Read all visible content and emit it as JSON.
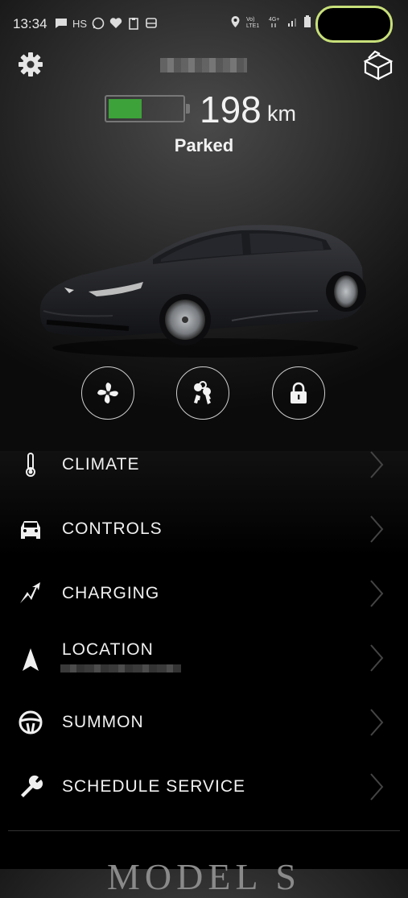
{
  "status_bar": {
    "time": "13:34",
    "notif_text": "HS",
    "network_volte": "Vo) LTE1",
    "network_type": "4G+"
  },
  "vehicle": {
    "name_redacted": "",
    "range_value": "198",
    "range_unit": "km",
    "battery_level": 0.45,
    "battery_color": "#3da23a",
    "state": "Parked"
  },
  "quick_actions": [
    {
      "icon": "fan-icon",
      "label": ""
    },
    {
      "icon": "key-icon",
      "label": ""
    },
    {
      "icon": "lock-icon",
      "label": ""
    }
  ],
  "menu": [
    {
      "label": "CLIMATE",
      "icon": "thermometer-icon"
    },
    {
      "label": "CONTROLS",
      "icon": "car-front-icon"
    },
    {
      "label": "CHARGING",
      "icon": "lightning-icon"
    },
    {
      "label": "LOCATION",
      "icon": "navigation-arrow-icon",
      "subtitle_redacted": true
    },
    {
      "label": "SUMMON",
      "icon": "steering-wheel-icon"
    },
    {
      "label": "SCHEDULE SERVICE",
      "icon": "wrench-icon"
    }
  ],
  "footer": {
    "brand": "MODEL S"
  }
}
